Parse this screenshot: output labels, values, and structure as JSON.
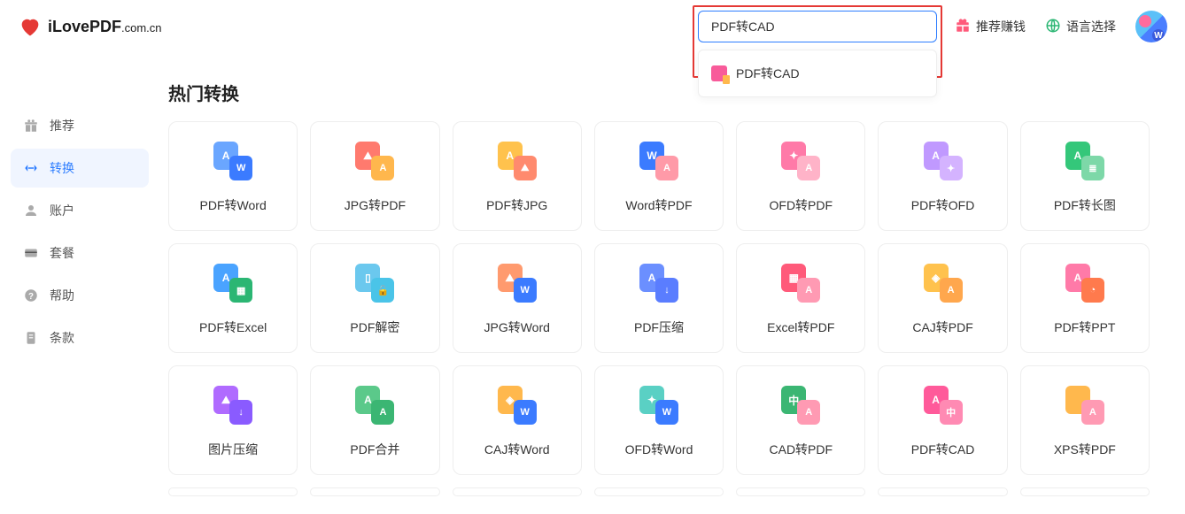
{
  "brand": {
    "name": "iLovePDF",
    "ext": ".com.cn"
  },
  "search": {
    "value": "PDF转CAD",
    "suggestion": "PDF转CAD"
  },
  "header_links": {
    "recommend": "推荐赚钱",
    "language": "语言选择"
  },
  "sidebar": [
    {
      "label": "推荐",
      "icon": "gift",
      "active": false
    },
    {
      "label": "转换",
      "icon": "convert",
      "active": true
    },
    {
      "label": "账户",
      "icon": "user",
      "active": false
    },
    {
      "label": "套餐",
      "icon": "card",
      "active": false
    },
    {
      "label": "帮助",
      "icon": "help",
      "active": false
    },
    {
      "label": "条款",
      "icon": "doc",
      "active": false
    }
  ],
  "section_title": "热门转换",
  "cards": [
    {
      "label": "PDF转Word",
      "c1": "#6aa6ff",
      "c2": "#3b7bff",
      "g1": "A",
      "g2": "W"
    },
    {
      "label": "JPG转PDF",
      "c1": "#ff7a6e",
      "c2": "#ffb74d",
      "g1": "⛰",
      "g2": "A"
    },
    {
      "label": "PDF转JPG",
      "c1": "#ffc24d",
      "c2": "#ff8a6e",
      "g1": "A",
      "g2": "⛰"
    },
    {
      "label": "Word转PDF",
      "c1": "#3b7bff",
      "c2": "#ff9aa8",
      "g1": "W",
      "g2": "A"
    },
    {
      "label": "OFD转PDF",
      "c1": "#ff7aa8",
      "c2": "#ffb3c8",
      "g1": "✦",
      "g2": "A"
    },
    {
      "label": "PDF转OFD",
      "c1": "#c099ff",
      "c2": "#d4b3ff",
      "g1": "A",
      "g2": "✦"
    },
    {
      "label": "PDF转长图",
      "c1": "#34c77a",
      "c2": "#7dd8a8",
      "g1": "A",
      "g2": "≣"
    },
    {
      "label": "PDF转Excel",
      "c1": "#4aa3ff",
      "c2": "#2bb673",
      "g1": "A",
      "g2": "▦"
    },
    {
      "label": "PDF解密",
      "c1": "#6bc8ee",
      "c2": "#4ac4e8",
      "g1": "▯",
      "g2": "🔓"
    },
    {
      "label": "JPG转Word",
      "c1": "#ff9a6e",
      "c2": "#3b7bff",
      "g1": "⛰",
      "g2": "W"
    },
    {
      "label": "PDF压缩",
      "c1": "#6b8fff",
      "c2": "#5a7dff",
      "g1": "A",
      "g2": "↓"
    },
    {
      "label": "Excel转PDF",
      "c1": "#ff5a7a",
      "c2": "#ff9ab3",
      "g1": "▦",
      "g2": "A"
    },
    {
      "label": "CAJ转PDF",
      "c1": "#ffc24d",
      "c2": "#ffa74d",
      "g1": "◈",
      "g2": "A"
    },
    {
      "label": "PDF转PPT",
      "c1": "#ff7aa8",
      "c2": "#ff7a4d",
      "g1": "A",
      "g2": "◔"
    },
    {
      "label": "图片压缩",
      "c1": "#b06bff",
      "c2": "#8a5bff",
      "g1": "⛰",
      "g2": "↓"
    },
    {
      "label": "PDF合并",
      "c1": "#5bc98a",
      "c2": "#3bb673",
      "g1": "A",
      "g2": "A"
    },
    {
      "label": "CAJ转Word",
      "c1": "#ffb84d",
      "c2": "#3b7bff",
      "g1": "◈",
      "g2": "W"
    },
    {
      "label": "OFD转Word",
      "c1": "#5ad0c4",
      "c2": "#3b7bff",
      "g1": "✦",
      "g2": "W"
    },
    {
      "label": "CAD转PDF",
      "c1": "#3bb673",
      "c2": "#ff9ab3",
      "g1": "中",
      "g2": "A"
    },
    {
      "label": "PDF转CAD",
      "c1": "#ff5a9a",
      "c2": "#ff8ab3",
      "g1": "A",
      "g2": "中"
    },
    {
      "label": "XPS转PDF",
      "c1": "#ffb84d",
      "c2": "#ff9ab3",
      "g1": "</>",
      "g2": "A"
    }
  ]
}
